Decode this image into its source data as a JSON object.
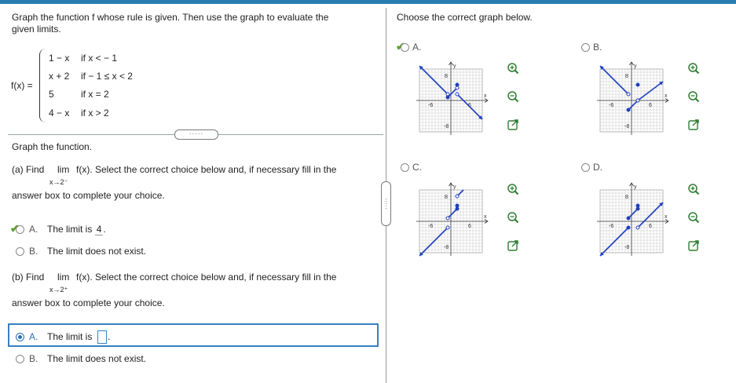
{
  "left": {
    "instruction": "Graph the function f whose rule is given. Then use the graph to evaluate the given limits.",
    "instruction_line1": "Graph the function f whose rule is given. Then use the graph to evaluate the",
    "instruction_line2": "given limits.",
    "function_label": "f(x) =",
    "pieces": [
      {
        "expr": "1 − x",
        "cond": "if  x < − 1"
      },
      {
        "expr": "x + 2",
        "cond": "if  − 1 ≤ x < 2"
      },
      {
        "expr": "5",
        "cond": "if  x = 2"
      },
      {
        "expr": "4 − x",
        "cond": "if  x > 2"
      }
    ],
    "more_label": "·····",
    "graph_prompt": "Graph the function.",
    "part_a": {
      "prefix": "(a) Find",
      "lim": "lim",
      "func": "f(x). Select the correct choice below and, if necessary fill in the",
      "subscript": "x→2⁻",
      "line2": "answer box to complete your choice.",
      "choice_a_letter": "A.",
      "choice_a_text": "The limit is",
      "choice_a_value": "4",
      "choice_a_suffix": ".",
      "choice_b_letter": "B.",
      "choice_b_text": "The limit does not exist."
    },
    "part_b": {
      "prefix": "(b) Find",
      "lim": "lim",
      "func": "f(x). Select the correct choice below and, if necessary fill in the",
      "subscript": "x→2⁺",
      "line2": "answer box to complete your choice.",
      "choice_a_letter": "A.",
      "choice_a_text": "The limit is",
      "choice_a_value": "",
      "choice_a_suffix": ".",
      "choice_b_letter": "B.",
      "choice_b_text": "The limit does not exist."
    }
  },
  "right": {
    "prompt": "Choose the correct graph below.",
    "options": [
      {
        "letter": "A.",
        "state": "checked"
      },
      {
        "letter": "B.",
        "state": "unselected"
      },
      {
        "letter": "C.",
        "state": "unselected"
      },
      {
        "letter": "D.",
        "state": "unselected"
      }
    ],
    "axis": {
      "xlabel": "x",
      "ylabel": "y",
      "xmin_label": "-6",
      "xmax_label": "6",
      "ymax_label": "8",
      "ymin_label": "-8"
    }
  },
  "icons": [
    "zoom-in-icon",
    "zoom-out-icon",
    "popout-icon"
  ],
  "colors": {
    "accent": "#2a7db3",
    "check": "#5aa02c",
    "curve": "#1f3fbf",
    "selected_border": "#3a7fc1"
  }
}
